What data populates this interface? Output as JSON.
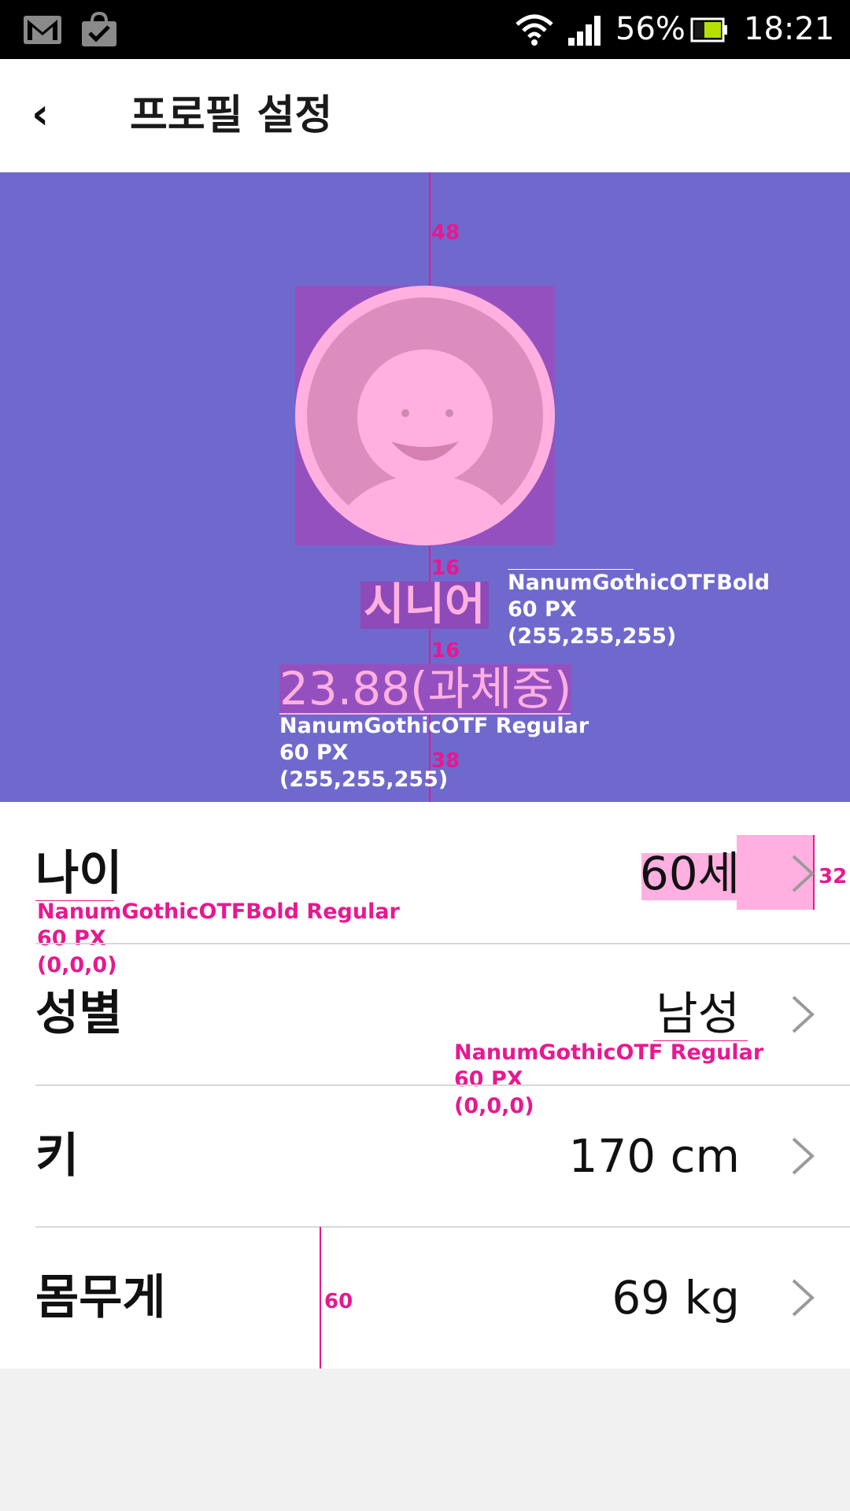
{
  "status_bar": {
    "icons": [
      "gmail-icon",
      "shopping-bag-check-icon",
      "wifi-icon",
      "signal-icon",
      "battery-icon"
    ],
    "battery_percent": "56%",
    "time": "18:21"
  },
  "header": {
    "back_label": "‹",
    "title": "프로필 설정"
  },
  "profile": {
    "rank": "시니어",
    "bmi": "23.88(과체중)"
  },
  "annotations": {
    "spacing_top": "48",
    "spacing_avatar_rank": "16",
    "spacing_rank_bmi": "16",
    "spacing_bottom": "38",
    "spacing_chevron": "32",
    "spacing_left": "60",
    "rank_font": "NanumGothicOTFBold\n60 PX\n(255,255,255)",
    "bmi_font": "NanumGothicOTF Regular\n60 PX\n(255,255,255)",
    "label_font": "NanumGothicOTFBold Regular\n60 PX\n(0,0,0)",
    "value_font": "NanumGothicOTF Regular\n60 PX\n(0,0,0)"
  },
  "list": {
    "rows": [
      {
        "label": "나이",
        "value": "60세"
      },
      {
        "label": "성별",
        "value": "남성"
      },
      {
        "label": "키",
        "value": "170 cm"
      },
      {
        "label": "몸무게",
        "value": "69 kg"
      }
    ]
  },
  "colors": {
    "profile_bg": "#6f69cd",
    "accent_pink": "#ffb0e0",
    "annotation": "#e81890"
  }
}
